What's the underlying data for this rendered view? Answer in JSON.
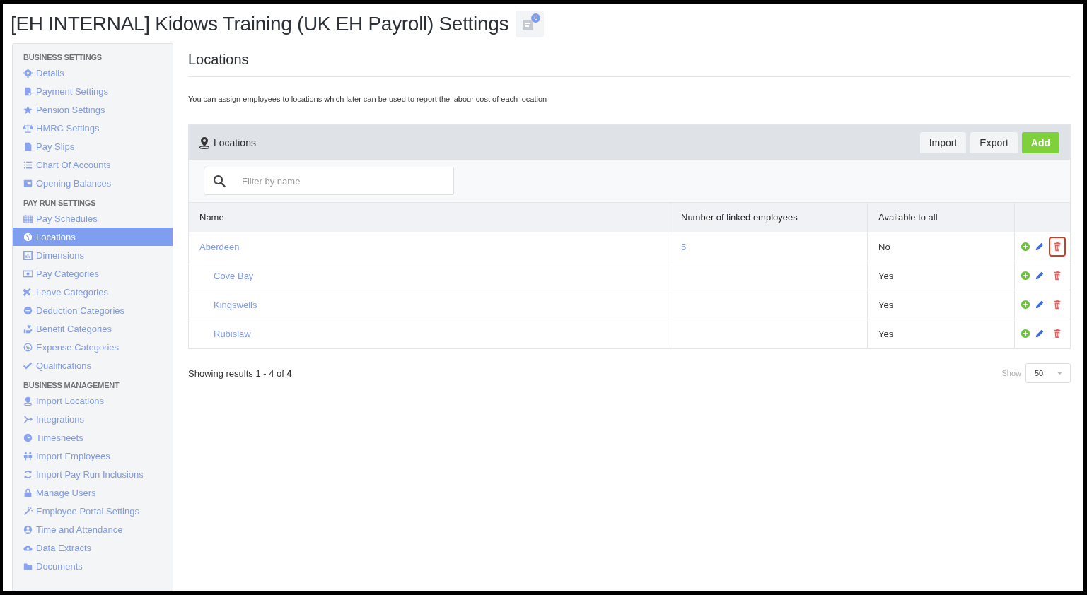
{
  "page_title": "[EH INTERNAL] Kidows Training (UK EH Payroll) Settings",
  "notifications": {
    "count": "0"
  },
  "sidebar": {
    "sections": [
      {
        "heading": "BUSINESS SETTINGS",
        "items": [
          {
            "label": "Details",
            "selected": false
          },
          {
            "label": "Payment Settings",
            "selected": false
          },
          {
            "label": "Pension Settings",
            "selected": false
          },
          {
            "label": "HMRC Settings",
            "selected": false
          },
          {
            "label": "Pay Slips",
            "selected": false
          },
          {
            "label": "Chart Of Accounts",
            "selected": false
          },
          {
            "label": "Opening Balances",
            "selected": false
          }
        ]
      },
      {
        "heading": "PAY RUN SETTINGS",
        "items": [
          {
            "label": "Pay Schedules",
            "selected": false
          },
          {
            "label": "Locations",
            "selected": true
          },
          {
            "label": "Dimensions",
            "selected": false
          },
          {
            "label": "Pay Categories",
            "selected": false
          },
          {
            "label": "Leave Categories",
            "selected": false
          },
          {
            "label": "Deduction Categories",
            "selected": false
          },
          {
            "label": "Benefit Categories",
            "selected": false
          },
          {
            "label": "Expense Categories",
            "selected": false
          },
          {
            "label": "Qualifications",
            "selected": false
          }
        ]
      },
      {
        "heading": "BUSINESS MANAGEMENT",
        "items": [
          {
            "label": "Import Locations",
            "selected": false
          },
          {
            "label": "Integrations",
            "selected": false
          },
          {
            "label": "Timesheets",
            "selected": false
          },
          {
            "label": "Import Employees",
            "selected": false
          },
          {
            "label": "Import Pay Run Inclusions",
            "selected": false
          },
          {
            "label": "Manage Users",
            "selected": false
          },
          {
            "label": "Employee Portal Settings",
            "selected": false
          },
          {
            "label": "Time and Attendance",
            "selected": false
          },
          {
            "label": "Data Extracts",
            "selected": false
          },
          {
            "label": "Documents",
            "selected": false
          }
        ]
      }
    ]
  },
  "heading": "Locations",
  "description": "You can assign employees to locations which later can be used to report the labour cost of each location",
  "panel": {
    "title": "Locations",
    "buttons": [
      {
        "label": "Import",
        "kind": "plain"
      },
      {
        "label": "Export",
        "kind": "plain"
      },
      {
        "label": "Add",
        "kind": "primary"
      }
    ],
    "filter": {
      "placeholder": "Filter by name"
    },
    "table": {
      "columns": [
        "Name",
        "Number of linked employees",
        "Available to all"
      ],
      "rows": [
        {
          "name": "Aberdeen",
          "employees": "5",
          "available": "No",
          "delete_highlighted": true,
          "children": [
            {
              "name": "Cove Bay",
              "available": "Yes",
              "delete_highlighted": false
            },
            {
              "name": "Kingswells",
              "available": "Yes",
              "delete_highlighted": false
            },
            {
              "name": "Rubislaw",
              "available": "Yes",
              "delete_highlighted": false
            }
          ]
        }
      ]
    }
  },
  "results": "Showing results 1 - 4 of **4**",
  "page_size": {
    "label": "Show",
    "value": "50"
  }
}
